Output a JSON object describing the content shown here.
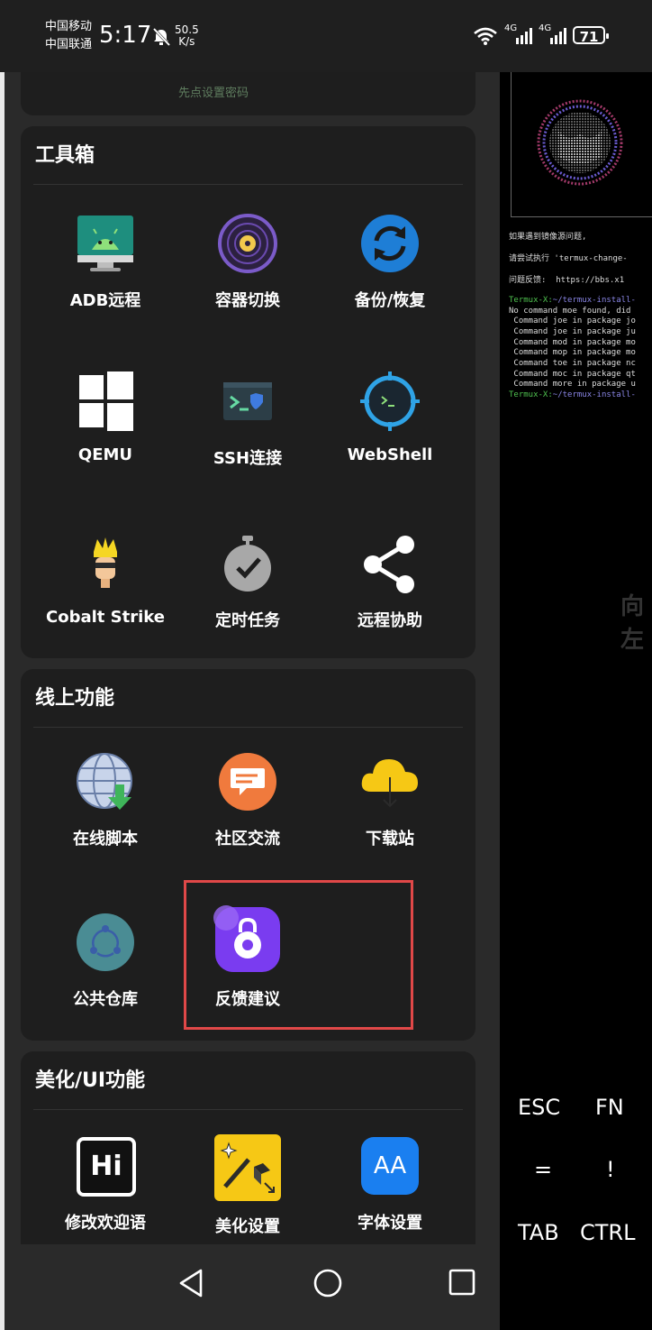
{
  "status_bar": {
    "carrier1": "中国移动",
    "carrier2": "中国联通",
    "time": "5:17",
    "net_speed_value": "50.5",
    "net_speed_unit": "K/s",
    "sig1_label": "4G",
    "sig2_label": "4G",
    "battery": "71"
  },
  "partial_top_text": "先点设置密码",
  "toolbox": {
    "title": "工具箱",
    "items": [
      "ADB远程",
      "容器切换",
      "备份/恢复",
      "QEMU",
      "SSH连接",
      "WebShell",
      "Cobalt Strike",
      "定时任务",
      "远程协助"
    ]
  },
  "online": {
    "title": "线上功能",
    "items": [
      "在线脚本",
      "社区交流",
      "下载站",
      "公共仓库",
      "反馈建议"
    ]
  },
  "beautify": {
    "title": "美化/UI功能",
    "items": [
      "修改欢迎语",
      "美化设置",
      "字体设置"
    ],
    "icon_text_hi": "Hi",
    "icon_text_aa": "AA"
  },
  "terminal": {
    "lines": [
      "如果遇到镜像源问题,",
      "请尝试执行 'termux-change-",
      "问题反馈:  https://bbs.x1"
    ],
    "prompt1": "Termux-X:",
    "path1": "~/termux-install-",
    "out": [
      "No command moe found, did",
      " Command joe in package jo",
      " Command joe in package ju",
      " Command mod in package mo",
      " Command mop in package mo",
      " Command toe in package nc",
      " Command moc in package qt",
      " Command more in package u"
    ],
    "prompt2": "Termux-X:",
    "path2": "~/termux-install-",
    "side_text": "向左",
    "keys": [
      "ESC",
      "FN",
      "=",
      "!",
      "TAB",
      "CTRL"
    ]
  },
  "colors": {
    "panel_bg": "#2a2a2a",
    "card_bg": "#1e1e1e",
    "highlight": "#e04848",
    "terminal_bg": "#000000",
    "prompt_green": "#4fc14f"
  }
}
